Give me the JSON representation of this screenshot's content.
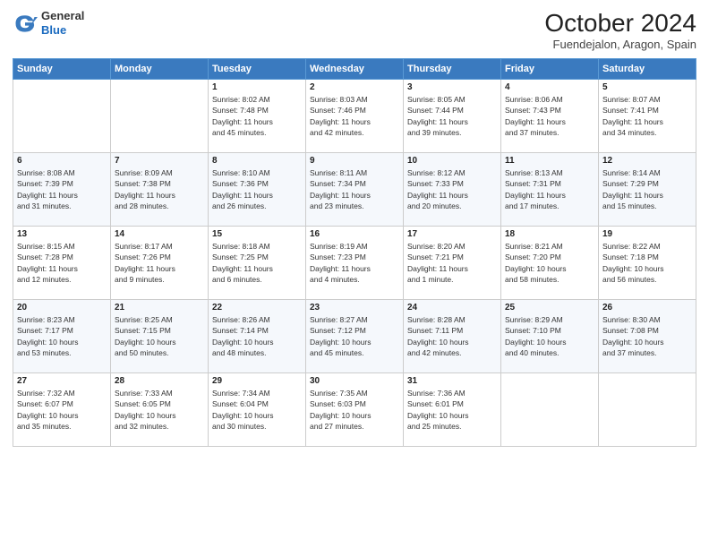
{
  "header": {
    "logo_general": "General",
    "logo_blue": "Blue",
    "month": "October 2024",
    "location": "Fuendejalon, Aragon, Spain"
  },
  "weekdays": [
    "Sunday",
    "Monday",
    "Tuesday",
    "Wednesday",
    "Thursday",
    "Friday",
    "Saturday"
  ],
  "weeks": [
    [
      {
        "day": "",
        "info": ""
      },
      {
        "day": "",
        "info": ""
      },
      {
        "day": "1",
        "info": "Sunrise: 8:02 AM\nSunset: 7:48 PM\nDaylight: 11 hours\nand 45 minutes."
      },
      {
        "day": "2",
        "info": "Sunrise: 8:03 AM\nSunset: 7:46 PM\nDaylight: 11 hours\nand 42 minutes."
      },
      {
        "day": "3",
        "info": "Sunrise: 8:05 AM\nSunset: 7:44 PM\nDaylight: 11 hours\nand 39 minutes."
      },
      {
        "day": "4",
        "info": "Sunrise: 8:06 AM\nSunset: 7:43 PM\nDaylight: 11 hours\nand 37 minutes."
      },
      {
        "day": "5",
        "info": "Sunrise: 8:07 AM\nSunset: 7:41 PM\nDaylight: 11 hours\nand 34 minutes."
      }
    ],
    [
      {
        "day": "6",
        "info": "Sunrise: 8:08 AM\nSunset: 7:39 PM\nDaylight: 11 hours\nand 31 minutes."
      },
      {
        "day": "7",
        "info": "Sunrise: 8:09 AM\nSunset: 7:38 PM\nDaylight: 11 hours\nand 28 minutes."
      },
      {
        "day": "8",
        "info": "Sunrise: 8:10 AM\nSunset: 7:36 PM\nDaylight: 11 hours\nand 26 minutes."
      },
      {
        "day": "9",
        "info": "Sunrise: 8:11 AM\nSunset: 7:34 PM\nDaylight: 11 hours\nand 23 minutes."
      },
      {
        "day": "10",
        "info": "Sunrise: 8:12 AM\nSunset: 7:33 PM\nDaylight: 11 hours\nand 20 minutes."
      },
      {
        "day": "11",
        "info": "Sunrise: 8:13 AM\nSunset: 7:31 PM\nDaylight: 11 hours\nand 17 minutes."
      },
      {
        "day": "12",
        "info": "Sunrise: 8:14 AM\nSunset: 7:29 PM\nDaylight: 11 hours\nand 15 minutes."
      }
    ],
    [
      {
        "day": "13",
        "info": "Sunrise: 8:15 AM\nSunset: 7:28 PM\nDaylight: 11 hours\nand 12 minutes."
      },
      {
        "day": "14",
        "info": "Sunrise: 8:17 AM\nSunset: 7:26 PM\nDaylight: 11 hours\nand 9 minutes."
      },
      {
        "day": "15",
        "info": "Sunrise: 8:18 AM\nSunset: 7:25 PM\nDaylight: 11 hours\nand 6 minutes."
      },
      {
        "day": "16",
        "info": "Sunrise: 8:19 AM\nSunset: 7:23 PM\nDaylight: 11 hours\nand 4 minutes."
      },
      {
        "day": "17",
        "info": "Sunrise: 8:20 AM\nSunset: 7:21 PM\nDaylight: 11 hours\nand 1 minute."
      },
      {
        "day": "18",
        "info": "Sunrise: 8:21 AM\nSunset: 7:20 PM\nDaylight: 10 hours\nand 58 minutes."
      },
      {
        "day": "19",
        "info": "Sunrise: 8:22 AM\nSunset: 7:18 PM\nDaylight: 10 hours\nand 56 minutes."
      }
    ],
    [
      {
        "day": "20",
        "info": "Sunrise: 8:23 AM\nSunset: 7:17 PM\nDaylight: 10 hours\nand 53 minutes."
      },
      {
        "day": "21",
        "info": "Sunrise: 8:25 AM\nSunset: 7:15 PM\nDaylight: 10 hours\nand 50 minutes."
      },
      {
        "day": "22",
        "info": "Sunrise: 8:26 AM\nSunset: 7:14 PM\nDaylight: 10 hours\nand 48 minutes."
      },
      {
        "day": "23",
        "info": "Sunrise: 8:27 AM\nSunset: 7:12 PM\nDaylight: 10 hours\nand 45 minutes."
      },
      {
        "day": "24",
        "info": "Sunrise: 8:28 AM\nSunset: 7:11 PM\nDaylight: 10 hours\nand 42 minutes."
      },
      {
        "day": "25",
        "info": "Sunrise: 8:29 AM\nSunset: 7:10 PM\nDaylight: 10 hours\nand 40 minutes."
      },
      {
        "day": "26",
        "info": "Sunrise: 8:30 AM\nSunset: 7:08 PM\nDaylight: 10 hours\nand 37 minutes."
      }
    ],
    [
      {
        "day": "27",
        "info": "Sunrise: 7:32 AM\nSunset: 6:07 PM\nDaylight: 10 hours\nand 35 minutes."
      },
      {
        "day": "28",
        "info": "Sunrise: 7:33 AM\nSunset: 6:05 PM\nDaylight: 10 hours\nand 32 minutes."
      },
      {
        "day": "29",
        "info": "Sunrise: 7:34 AM\nSunset: 6:04 PM\nDaylight: 10 hours\nand 30 minutes."
      },
      {
        "day": "30",
        "info": "Sunrise: 7:35 AM\nSunset: 6:03 PM\nDaylight: 10 hours\nand 27 minutes."
      },
      {
        "day": "31",
        "info": "Sunrise: 7:36 AM\nSunset: 6:01 PM\nDaylight: 10 hours\nand 25 minutes."
      },
      {
        "day": "",
        "info": ""
      },
      {
        "day": "",
        "info": ""
      }
    ]
  ]
}
